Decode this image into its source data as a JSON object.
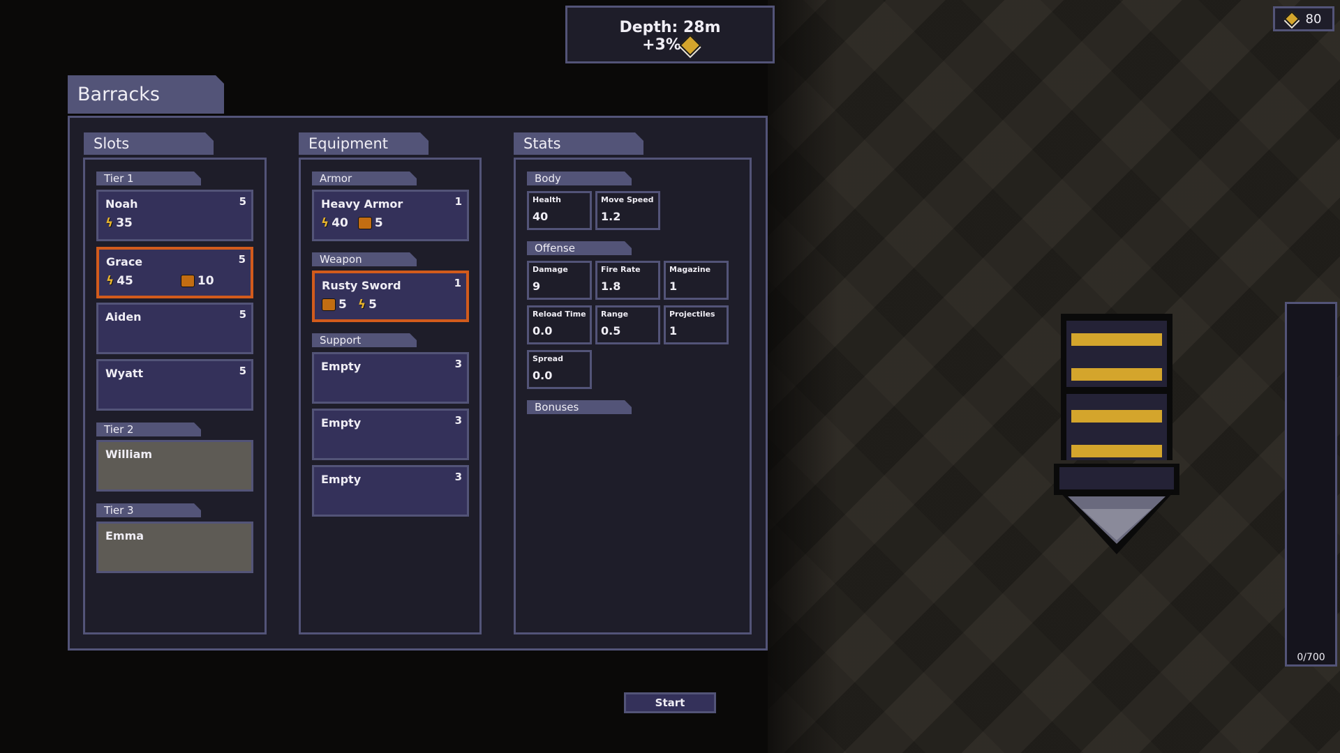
{
  "hud": {
    "depth_label": "Depth: 28m",
    "depth_bonus": "+3%",
    "currency": "80",
    "capacity": "0/700",
    "capacity_fraction": 0
  },
  "barracks": {
    "title": "Barracks",
    "start_label": "Start",
    "slots": {
      "title": "Slots",
      "tiers": [
        {
          "label": "Tier 1",
          "units": [
            {
              "name": "Noah",
              "level": "5",
              "energy": "35",
              "ore": null,
              "selected": false
            },
            {
              "name": "Grace",
              "level": "5",
              "energy": "45",
              "ore": "10",
              "selected": true
            },
            {
              "name": "Aiden",
              "level": "5",
              "energy": null,
              "ore": null,
              "selected": false
            },
            {
              "name": "Wyatt",
              "level": "5",
              "energy": null,
              "ore": null,
              "selected": false
            }
          ]
        },
        {
          "label": "Tier 2",
          "units": [
            {
              "name": "William",
              "locked": true
            }
          ]
        },
        {
          "label": "Tier 3",
          "units": [
            {
              "name": "Emma",
              "locked": true
            }
          ]
        }
      ]
    },
    "equipment": {
      "title": "Equipment",
      "armor": {
        "label": "Armor",
        "item": {
          "name": "Heavy Armor",
          "level": "1",
          "energy": "40",
          "ore": "5"
        }
      },
      "weapon": {
        "label": "Weapon",
        "item": {
          "name": "Rusty Sword",
          "level": "1",
          "ore": "5",
          "energy": "5"
        }
      },
      "support": {
        "label": "Support",
        "items": [
          {
            "name": "Empty",
            "level": "3"
          },
          {
            "name": "Empty",
            "level": "3"
          },
          {
            "name": "Empty",
            "level": "3"
          }
        ]
      }
    },
    "stats": {
      "title": "Stats",
      "body": {
        "label": "Body",
        "items": [
          {
            "label": "Health",
            "value": "40"
          },
          {
            "label": "Move Speed",
            "value": "1.2"
          }
        ]
      },
      "offense": {
        "label": "Offense",
        "items": [
          {
            "label": "Damage",
            "value": "9"
          },
          {
            "label": "Fire Rate",
            "value": "1.8"
          },
          {
            "label": "Magazine",
            "value": "1"
          },
          {
            "label": "Reload Time",
            "value": "0.0"
          },
          {
            "label": "Range",
            "value": "0.5"
          },
          {
            "label": "Projectiles",
            "value": "1"
          },
          {
            "label": "Spread",
            "value": "0.0"
          }
        ]
      },
      "bonuses": {
        "label": "Bonuses"
      }
    }
  },
  "icons": {
    "energy": "⚡",
    "colors": {
      "accent_selected": "#d25b1c",
      "panel": "#535478",
      "card": "#34315a",
      "gold": "#d4a52c"
    }
  }
}
